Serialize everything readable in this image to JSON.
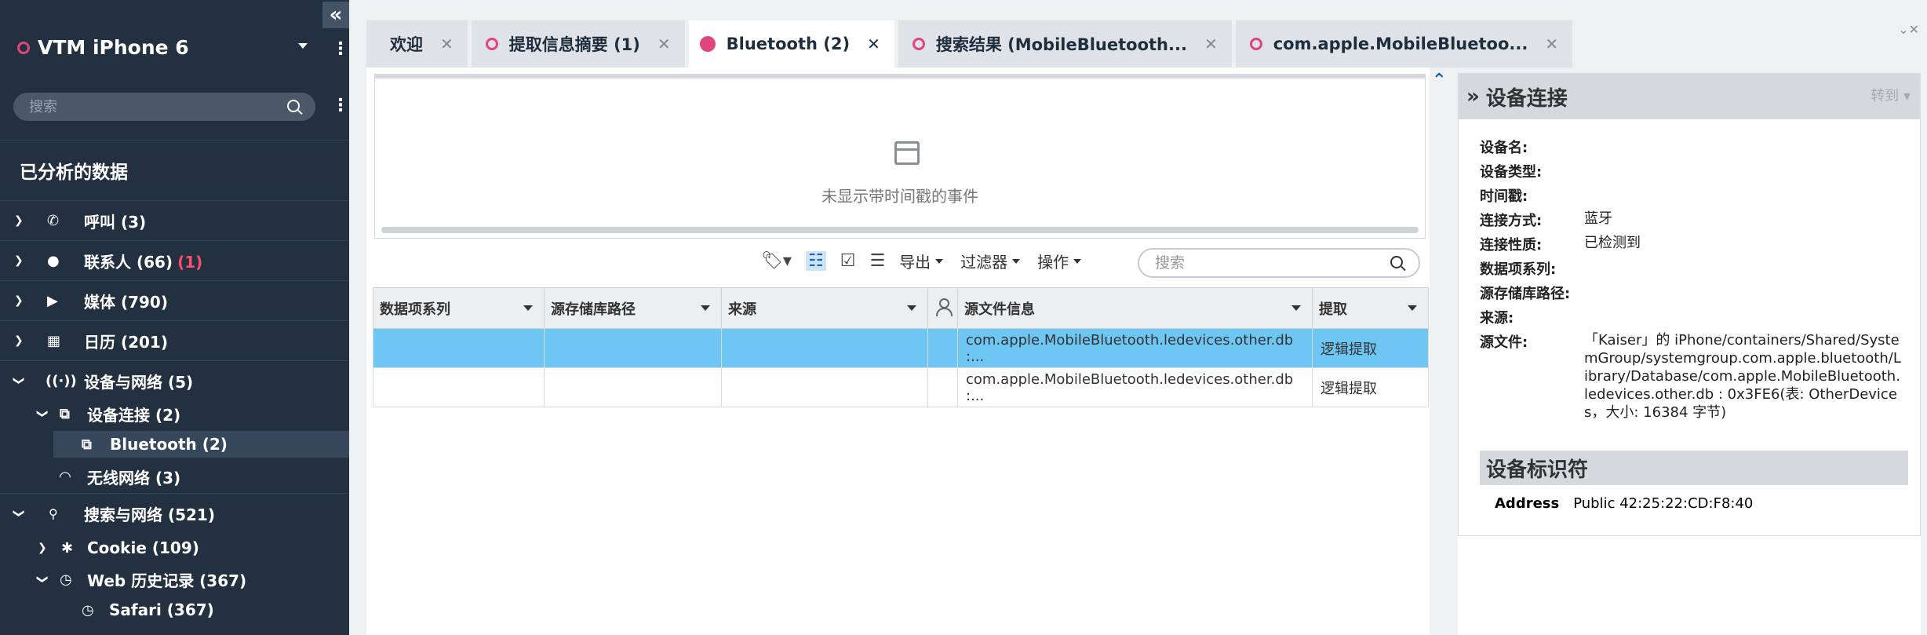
{
  "sidebar": {
    "case_title": "VTM iPhone 6",
    "search_placeholder": "搜索",
    "section_title": "已分析的数据",
    "items": [
      {
        "label": "呼叫 (3)"
      },
      {
        "label": "联系人 (66)",
        "badge": "(1)"
      },
      {
        "label": "媒体 (790)"
      },
      {
        "label": "日历 (201)"
      },
      {
        "label": "设备与网络 (5)"
      },
      {
        "label": "设备连接 (2)"
      },
      {
        "label": "Bluetooth (2)"
      },
      {
        "label": "无线网络 (3)"
      },
      {
        "label": "搜索与网络 (521)"
      },
      {
        "label": "Cookie (109)"
      },
      {
        "label": "Web 历史记录 (367)"
      },
      {
        "label": "Safari (367)"
      }
    ]
  },
  "tabs": [
    {
      "label": "欢迎"
    },
    {
      "label": "提取信息摘要 (1)"
    },
    {
      "label": "Bluetooth (2)"
    },
    {
      "label": "搜索结果 (MobileBluetooth..."
    },
    {
      "label": "com.apple.MobileBluetoo..."
    }
  ],
  "timeline": {
    "empty_text": "未显示带时间戳的事件"
  },
  "toolbar": {
    "export": "导出",
    "filter": "过滤器",
    "actions": "操作",
    "search_placeholder": "搜索"
  },
  "grid": {
    "headers": [
      "数据项系列",
      "源存储库路径",
      "来源",
      "",
      "源文件信息",
      "提取"
    ],
    "rows": [
      {
        "source_file": "com.apple.MobileBluetooth.ledevices.other.db :...",
        "extraction": "逻辑提取"
      },
      {
        "source_file": "com.apple.MobileBluetooth.ledevices.other.db :...",
        "extraction": "逻辑提取"
      }
    ]
  },
  "detail": {
    "title": "设备连接",
    "goto": "转到",
    "fields": [
      {
        "key": "设备名:",
        "value": ""
      },
      {
        "key": "设备类型:",
        "value": ""
      },
      {
        "key": "时间戳:",
        "value": ""
      },
      {
        "key": "连接方式:",
        "value": "蓝牙"
      },
      {
        "key": "连接性质:",
        "value": "已检测到"
      },
      {
        "key": "数据项系列:",
        "value": ""
      },
      {
        "key": "源存储库路径:",
        "value": ""
      },
      {
        "key": "来源:",
        "value": ""
      },
      {
        "key": "源文件:",
        "value": "「Kaiser」的 iPhone/containers/Shared/SystemGroup/systemgroup.com.apple.bluetooth/Library/Database/com.apple.MobileBluetooth.ledevices.other.db : 0x3FE6(表: OtherDevices，大小: 16384 字节)"
      }
    ],
    "identifier_title": "设备标识符",
    "address_key": "Address",
    "address_value": "Public 42:25:22:CD:F8:40"
  }
}
